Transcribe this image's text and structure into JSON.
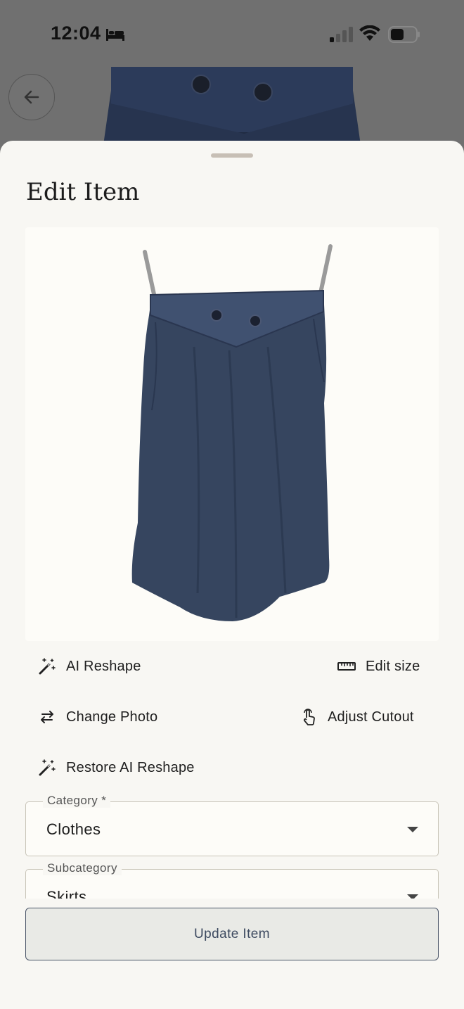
{
  "status_bar": {
    "time": "12:04"
  },
  "sheet": {
    "title": "Edit Item"
  },
  "actions": {
    "ai_reshape": "AI Reshape",
    "edit_size": "Edit size",
    "change_photo": "Change Photo",
    "adjust_cutout": "Adjust Cutout",
    "restore_ai_reshape": "Restore AI Reshape"
  },
  "form": {
    "category": {
      "label": "Category *",
      "value": "Clothes"
    },
    "subcategory": {
      "label": "Subcategory",
      "value": "Skirts"
    }
  },
  "footer": {
    "update_label": "Update Item"
  },
  "colors": {
    "sheet_background": "#f8f7f3",
    "skirt": "#2c3b5a",
    "button_border": "#4a5568"
  }
}
